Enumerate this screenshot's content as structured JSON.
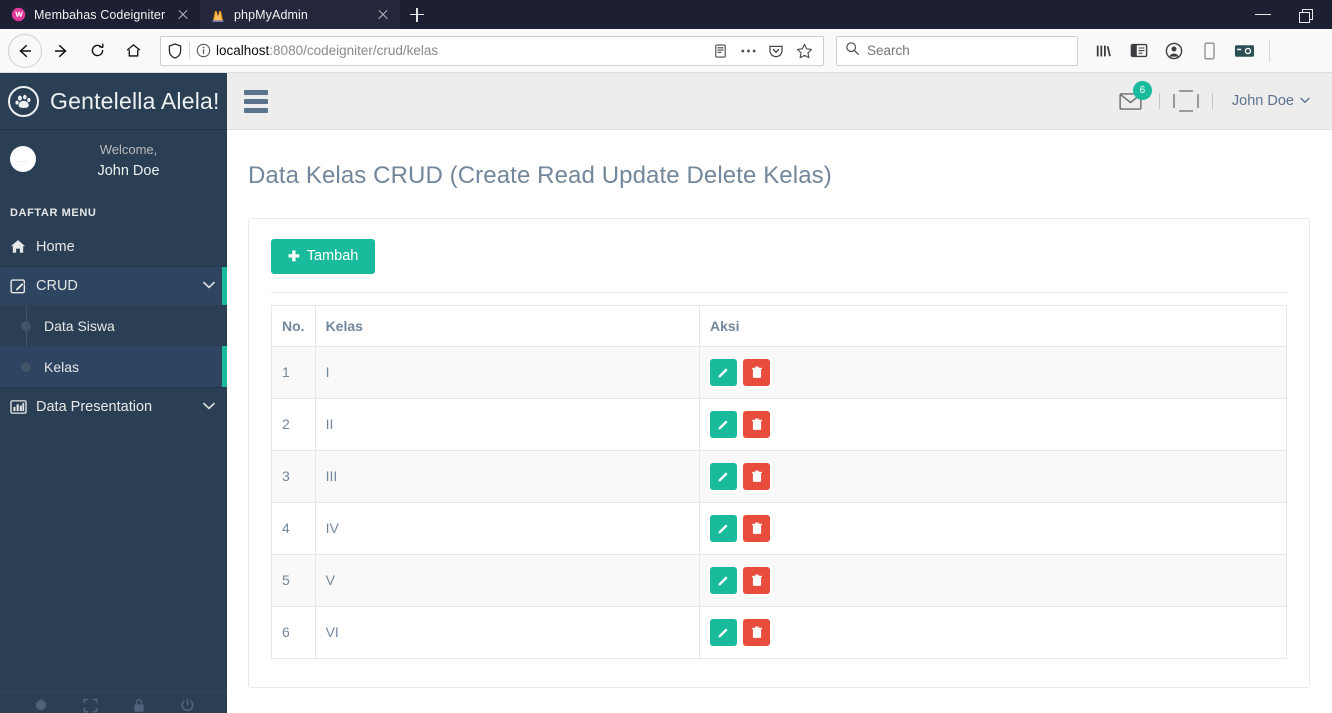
{
  "browser": {
    "tabs": [
      {
        "title": "Membahas Codeigniter",
        "favicon": "wordpress-icon",
        "active": false
      },
      {
        "title": "phpMyAdmin",
        "favicon": "phpmyadmin-icon",
        "active": true
      }
    ],
    "newtab_label": "+",
    "window_controls": {
      "minimize": "minimize-icon",
      "maximize": "maximize-icon"
    },
    "toolbar": {
      "back": "back-arrow-icon",
      "forward": "forward-arrow-icon",
      "reload": "reload-icon",
      "home": "home-icon",
      "shield": "shield-icon",
      "info": "info-circle-icon",
      "url_host": "localhost",
      "url_rest": ":8080/codeigniter/crud/kelas",
      "reader": "reader-view-icon",
      "page_actions": "ellipsis-icon",
      "pocket": "pocket-icon",
      "bookmark": "star-icon",
      "search_placeholder": "Search",
      "search_value": "",
      "library": "library-icon",
      "sidebars": "sidebar-icon",
      "account": "account-icon",
      "responsive": "mobile-icon",
      "screenshot": "screenshot-icon"
    }
  },
  "sidebar": {
    "brand": "Gentelella Alela!",
    "brand_icon": "paw-icon",
    "profile": {
      "avatar": "user-avatar",
      "welcome": "Welcome,",
      "name": "John Doe"
    },
    "section_title": "DAFTAR MENU",
    "items": [
      {
        "label": "Home",
        "icon": "home-icon",
        "has_children": false,
        "open": false
      },
      {
        "label": "CRUD",
        "icon": "edit-square-icon",
        "has_children": true,
        "open": true,
        "chevron": "⌄",
        "children": [
          {
            "label": "Data Siswa",
            "active": false
          },
          {
            "label": "Kelas",
            "active": true
          }
        ]
      },
      {
        "label": "Data Presentation",
        "icon": "bar-chart-icon",
        "has_children": true,
        "open": false,
        "chevron": "⌄",
        "children": []
      }
    ],
    "footer_icons": [
      "settings-icon",
      "fullscreen-icon",
      "lock-icon",
      "power-icon"
    ]
  },
  "topnav": {
    "toggle_icon": "hamburger-icon",
    "messages_icon": "envelope-icon",
    "messages_count": "6",
    "user_avatar": "broken-image-icon",
    "user_name": "John Doe",
    "user_caret": "⌄"
  },
  "main": {
    "page_title": "Data Kelas CRUD (Create Read Update Delete Kelas)",
    "add_button": {
      "label": "Tambah",
      "icon": "plus-icon"
    },
    "table": {
      "columns": [
        "No.",
        "Kelas",
        "Aksi"
      ],
      "rows": [
        {
          "no": "1",
          "kelas": "I",
          "edit": "pencil-icon",
          "delete": "trash-icon"
        },
        {
          "no": "2",
          "kelas": "II",
          "edit": "pencil-icon",
          "delete": "trash-icon"
        },
        {
          "no": "3",
          "kelas": "III",
          "edit": "pencil-icon",
          "delete": "trash-icon"
        },
        {
          "no": "4",
          "kelas": "IV",
          "edit": "pencil-icon",
          "delete": "trash-icon"
        },
        {
          "no": "5",
          "kelas": "V",
          "edit": "pencil-icon",
          "delete": "trash-icon"
        },
        {
          "no": "6",
          "kelas": "VI",
          "edit": "pencil-icon",
          "delete": "trash-icon"
        }
      ]
    }
  },
  "colors": {
    "sidebar_bg": "#2A3F54",
    "accent_green": "#1ABB9C",
    "danger_red": "#E74C3C",
    "text_muted": "#73879C",
    "topnav_bg": "#EDEDED",
    "tabstrip_bg": "#1D1F32"
  }
}
